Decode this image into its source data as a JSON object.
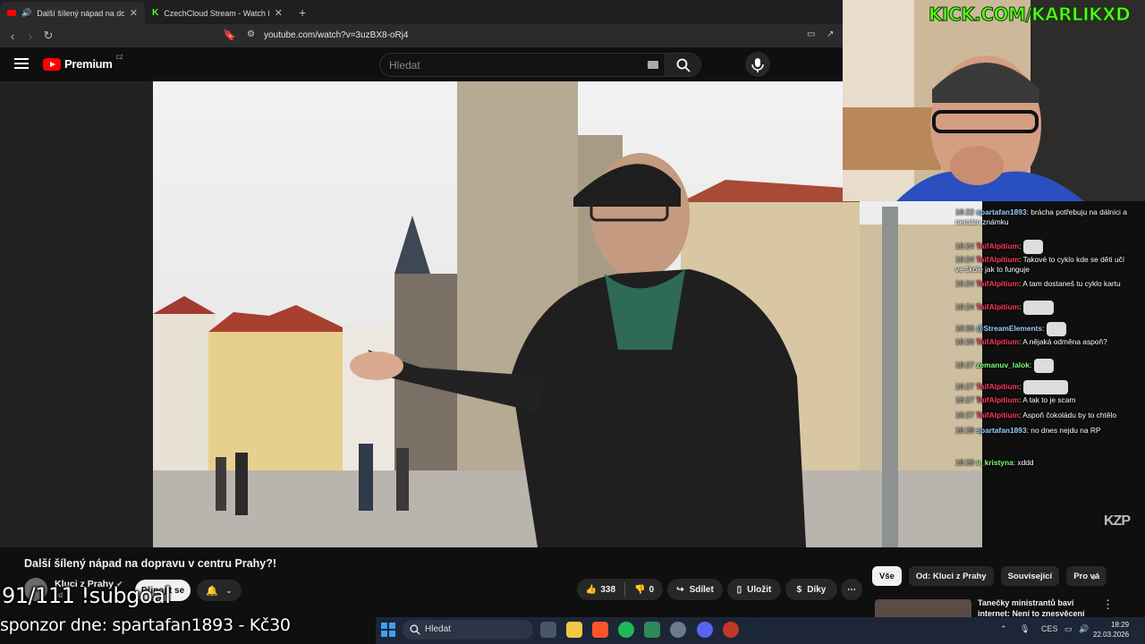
{
  "browser": {
    "tabs": [
      {
        "title": "Další šílený nápad na doprav",
        "active": true
      },
      {
        "title": "CzechCloud Stream - Watch Live on",
        "active": false
      }
    ],
    "new_tab": "+",
    "url": "youtube.com/watch?v=3uzBX8-oRj4"
  },
  "youtube": {
    "logo_text": "Premium",
    "logo_region": "CZ",
    "search_placeholder": "Hledat",
    "video_title": "Další šílený nápad na dopravu v centru Prahy?!",
    "channel_name": "Kluci z Prahy",
    "subscribers": "od",
    "join_label": "Připojit se",
    "likes": "338",
    "dislikes": "0",
    "share_label": "Sdílet",
    "save_label": "Uložit",
    "thanks_label": "Díky",
    "chips": [
      "Vše",
      "Od: Kluci z Prahy",
      "Související",
      "Pro vá"
    ],
    "rec_title": "Tanečky ministrantů baví internet: Není to znesvěcení",
    "watermark": "KZP"
  },
  "stream": {
    "kick_url": "KICK.COM/KARLIKXD",
    "subgoal": "91/111 !subgoal",
    "sponsor": "sponzor dne: spartafan1893 - Kč30"
  },
  "chat": [
    {
      "time": "18:22",
      "user": "spartafan1893",
      "color": "#9bd0ff",
      "text": ": brácha potřebuju na dálnici a nemám známku"
    },
    {
      "time": "18:24",
      "user": "TaifAlpitium",
      "color": "#ff3b5c",
      "text": ":"
    },
    {
      "time": "18:24",
      "user": "TaifAlpitium",
      "color": "#ff3b5c",
      "text": ": Takové to cyklo kde se děti učí ve škole jak to funguje"
    },
    {
      "time": "18:24",
      "user": "TaifAlpitium",
      "color": "#ff3b5c",
      "text": ": A tam dostaneš tu cyklo kartu"
    },
    {
      "time": "18:24",
      "user": "TaifAlpitium",
      "color": "#ff3b5c",
      "text": ":"
    },
    {
      "time": "18:26",
      "user": "@StreamElements",
      "color": "#9bd0ff",
      "text": ":"
    },
    {
      "time": "18:26",
      "user": "TaifAlpitium",
      "color": "#ff3b5c",
      "text": ": A nějaká odměna aspoň?"
    },
    {
      "time": "18:27",
      "user": "zemanuv_lalok",
      "color": "#7dff7a",
      "text": ":"
    },
    {
      "time": "18:27",
      "user": "TaifAlpitium",
      "color": "#ff3b5c",
      "text": ":"
    },
    {
      "time": "18:27",
      "user": "TaifAlpitium",
      "color": "#ff3b5c",
      "text": ": A tak to je scam"
    },
    {
      "time": "18:27",
      "user": "TaifAlpitium",
      "color": "#ff3b5c",
      "text": ": Aspoň čokoládu by to chtělo"
    },
    {
      "time": "18:28",
      "user": "spartafan1893",
      "color": "#9bd0ff",
      "text": ": no dnes nejdu na RP"
    },
    {
      "time": "18:28",
      "user": "v_kristyna",
      "color": "#7dff7a",
      "text": ": xddd"
    }
  ],
  "taskbar": {
    "search_placeholder": "Hledat",
    "lang": "CES",
    "time": "18:29",
    "date": "22.03.2026"
  }
}
